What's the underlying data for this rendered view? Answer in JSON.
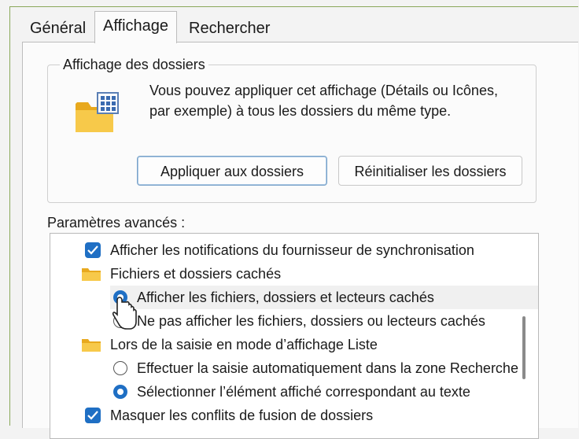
{
  "tabs": [
    {
      "label": "Général"
    },
    {
      "label": "Affichage"
    },
    {
      "label": "Rechercher"
    }
  ],
  "folder_view": {
    "title": "Affichage des dossiers",
    "description": "Vous pouvez appliquer cet affichage (Détails ou Icônes, par exemple) à tous les dossiers du même type.",
    "apply_button": "Appliquer aux dossiers",
    "reset_button": "Réinitialiser les dossiers"
  },
  "advanced": {
    "label": "Paramètres avancés :",
    "items": [
      {
        "type": "checkbox",
        "checked": true,
        "label": "Afficher les notifications du fournisseur de synchronisation"
      },
      {
        "type": "folder",
        "label": "Fichiers et dossiers cachés"
      },
      {
        "type": "radio",
        "checked": true,
        "label": "Afficher les fichiers, dossiers et lecteurs cachés"
      },
      {
        "type": "radio",
        "checked": false,
        "label": "Ne pas afficher les fichiers, dossiers ou lecteurs cachés"
      },
      {
        "type": "folder",
        "label": "Lors de la saisie en mode d’affichage Liste"
      },
      {
        "type": "radio",
        "checked": false,
        "label": "Effectuer la saisie automatiquement dans la zone Recherche"
      },
      {
        "type": "radio",
        "checked": true,
        "label": "Sélectionner l’élément affiché correspondant au texte"
      },
      {
        "type": "checkbox",
        "checked": true,
        "label": "Masquer les conflits de fusion de dossiers"
      }
    ]
  },
  "colors": {
    "accent": "#1f6fc4",
    "folder": "#f5c242"
  }
}
